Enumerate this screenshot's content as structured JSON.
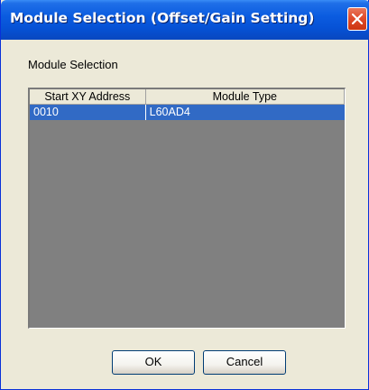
{
  "window": {
    "title": "Module Selection (Offset/Gain Setting)"
  },
  "group": {
    "label": "Module Selection"
  },
  "table": {
    "columns": [
      "Start XY Address",
      "Module Type"
    ],
    "rows": [
      {
        "address": "0010",
        "module_type": "L60AD4",
        "selected": true
      }
    ]
  },
  "buttons": {
    "ok": "OK",
    "cancel": "Cancel"
  },
  "icons": {
    "close": "close-icon"
  },
  "colors": {
    "titlebar": "#0652d6",
    "selection": "#316ac5",
    "list_background": "#808080",
    "close_button": "#e04c2c"
  }
}
